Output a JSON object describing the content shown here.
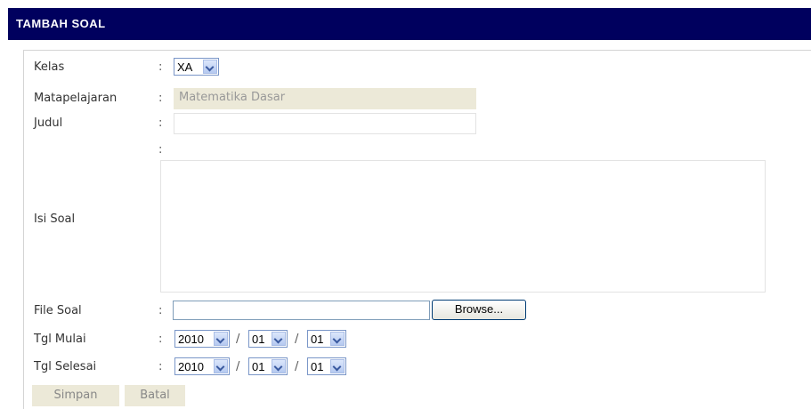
{
  "header": {
    "title": "TAMBAH SOAL"
  },
  "form": {
    "kelas": {
      "label": "Kelas",
      "colon": ":",
      "value": "XA"
    },
    "matapelajaran": {
      "label": "Matapelajaran",
      "colon": ":",
      "value": "Matematika Dasar"
    },
    "judul": {
      "label": "Judul",
      "colon": ":",
      "value": ""
    },
    "isi_soal": {
      "label": "Isi Soal",
      "colon": ":",
      "value": ""
    },
    "file_soal": {
      "label": "File Soal",
      "colon": ":",
      "value": "",
      "browse_label": "Browse..."
    },
    "tgl_mulai": {
      "label": "Tgl Mulai",
      "colon": ":",
      "year": "2010",
      "month": "01",
      "day": "01",
      "sep": "/"
    },
    "tgl_selesai": {
      "label": "Tgl Selesai",
      "colon": ":",
      "year": "2010",
      "month": "01",
      "day": "01",
      "sep": "/"
    }
  },
  "actions": {
    "save_label": "Simpan",
    "cancel_label": "Batal"
  },
  "colors": {
    "header_bg": "#00005e",
    "readonly_bg": "#ece9d8",
    "select_border": "#7a96c8"
  }
}
